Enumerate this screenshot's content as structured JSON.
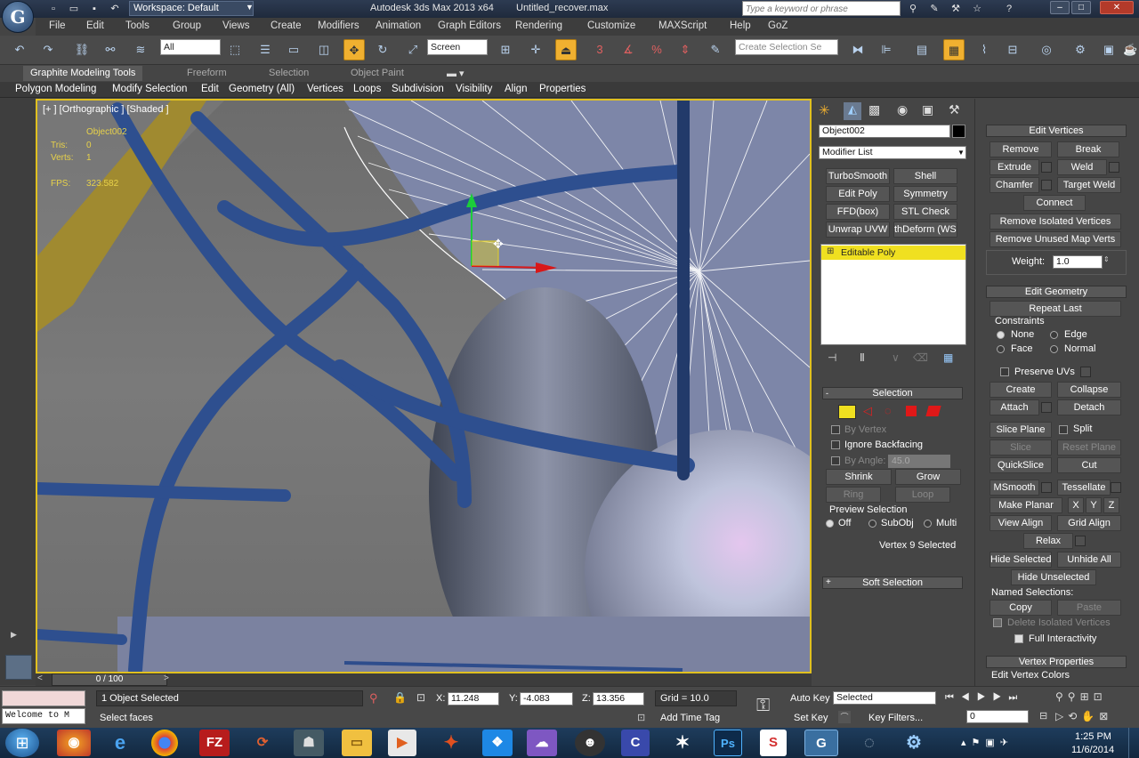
{
  "titlebar": {
    "workspace": "Workspace: Default",
    "app_title": "Autodesk 3ds Max  2013 x64",
    "file_title": "Untitled_recover.max",
    "search_placeholder": "Type a keyword or phrase"
  },
  "menu": [
    "File",
    "Edit",
    "Tools",
    "Group",
    "Views",
    "Create",
    "Modifiers",
    "Animation",
    "Graph Editors",
    "Rendering",
    "Customize",
    "MAXScript",
    "Help",
    "GoZ"
  ],
  "toolbar": {
    "selection_filter": "All",
    "reference_coord": "Screen",
    "named_selection_placeholder": "Create Selection Se"
  },
  "ribbon": {
    "tabs": [
      "Graphite Modeling Tools",
      "Freeform",
      "Selection",
      "Object Paint"
    ],
    "panels": [
      "Polygon Modeling",
      "Modify Selection",
      "Edit",
      "Geometry (All)",
      "Vertices",
      "Loops",
      "Subdivision",
      "Visibility",
      "Align",
      "Properties"
    ]
  },
  "viewport": {
    "label": "[+ ] [Orthographic ] [Shaded ]",
    "object_name": "Object002",
    "tris_label": "Tris:",
    "tris_value": "0",
    "verts_label": "Verts:",
    "verts_value": "1",
    "fps_label": "FPS:",
    "fps_value": "323.582"
  },
  "command_panel": {
    "object_name": "Object002",
    "modifier_list": "Modifier List",
    "modifier_buttons": [
      "TurboSmooth",
      "Shell",
      "Edit Poly",
      "Symmetry",
      "FFD(box)",
      "STL Check",
      "Unwrap UVW",
      "thDeform (WSI"
    ],
    "stack_item": "Editable Poly",
    "selection": {
      "header": "Selection",
      "by_vertex": "By Vertex",
      "ignore_backfacing": "Ignore Backfacing",
      "by_angle": "By Angle:",
      "angle_value": "45.0",
      "shrink": "Shrink",
      "grow": "Grow",
      "ring": "Ring",
      "loop": "Loop",
      "preview_selection": "Preview Selection",
      "off": "Off",
      "subobj": "SubObj",
      "multi": "Multi",
      "status": "Vertex 9 Selected"
    },
    "soft_selection": "Soft Selection"
  },
  "rollout": {
    "edit_vertices": "Edit Vertices",
    "remove": "Remove",
    "break": "Break",
    "extrude": "Extrude",
    "weld": "Weld",
    "chamfer": "Chamfer",
    "target_weld": "Target Weld",
    "connect": "Connect",
    "remove_isolated": "Remove Isolated Vertices",
    "remove_unused": "Remove Unused Map Verts",
    "weight_label": "Weight:",
    "weight_value": "1.0",
    "edit_geometry": "Edit Geometry",
    "repeat_last": "Repeat Last",
    "constraints": "Constraints",
    "none": "None",
    "edge": "Edge",
    "face": "Face",
    "normal": "Normal",
    "preserve_uvs": "Preserve UVs",
    "create": "Create",
    "collapse": "Collapse",
    "attach": "Attach",
    "detach": "Detach",
    "slice_plane": "Slice Plane",
    "split": "Split",
    "slice": "Slice",
    "reset_plane": "Reset Plane",
    "quickslice": "QuickSlice",
    "cut": "Cut",
    "msmooth": "MSmooth",
    "tessellate": "Tessellate",
    "make_planar": "Make Planar",
    "x": "X",
    "y": "Y",
    "z": "Z",
    "view_align": "View Align",
    "grid_align": "Grid Align",
    "relax": "Relax",
    "hide_selected": "Hide Selected",
    "unhide_all": "Unhide All",
    "hide_unselected": "Hide Unselected",
    "named_selections": "Named Selections:",
    "copy": "Copy",
    "paste": "Paste",
    "delete_isolated": "Delete Isolated Vertices",
    "full_interactivity": "Full Interactivity",
    "vertex_properties": "Vertex Properties",
    "edit_vertex_colors": "Edit Vertex Colors"
  },
  "status": {
    "timeslider": "0 / 100",
    "objects_selected": "1 Object Selected",
    "prompt": "Select faces",
    "maxscript": "Welcome to M",
    "x_label": "X:",
    "x_value": "11.248",
    "y_label": "Y:",
    "y_value": "-4.083",
    "z_label": "Z:",
    "z_value": "13.356",
    "grid": "Grid = 10.0",
    "add_time_tag": "Add Time Tag",
    "auto_key": "Auto Key",
    "set_key": "Set Key",
    "key_mode": "Selected",
    "key_filters": "Key Filters...",
    "frame": "0"
  },
  "taskbar": {
    "time": "1:25 PM",
    "date": "11/6/2014",
    "apps": [
      "Start",
      "Firefox",
      "Internet Explorer",
      "Chrome",
      "FileZilla",
      "App",
      "App",
      "Explorer",
      "Media Player",
      "App",
      "Dropbox",
      "App",
      "App",
      "App",
      "App",
      "Photoshop",
      "App",
      "3ds Max",
      "App",
      "App"
    ]
  },
  "colors": {
    "viewport_border": "#e0c020",
    "selection_yellow": "#f0e020",
    "accent_orange": "#f0b030"
  }
}
